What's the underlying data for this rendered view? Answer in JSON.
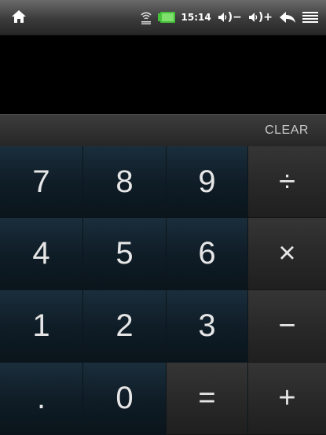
{
  "status_bar": {
    "time": "15:14",
    "volume_down_symbol": "◀))−",
    "volume_up_symbol": "◀))+",
    "icons": [
      "home-icon",
      "wifi-icon",
      "battery-icon",
      "volume-down-icon",
      "volume-up-icon",
      "back-icon",
      "menu-icon"
    ],
    "battery_color": "#45c23a"
  },
  "display": {
    "value": ""
  },
  "clear_label": "CLEAR",
  "keys": {
    "k7": "7",
    "k8": "8",
    "k9": "9",
    "divide": "÷",
    "k4": "4",
    "k5": "5",
    "k6": "6",
    "multiply": "×",
    "k1": "1",
    "k2": "2",
    "k3": "3",
    "minus": "−",
    "dot": ".",
    "k0": "0",
    "equals": "=",
    "plus": "+"
  },
  "colors": {
    "digit_key": "#0f1d27",
    "operator_key": "#282828",
    "text": "#e6e6e6"
  }
}
